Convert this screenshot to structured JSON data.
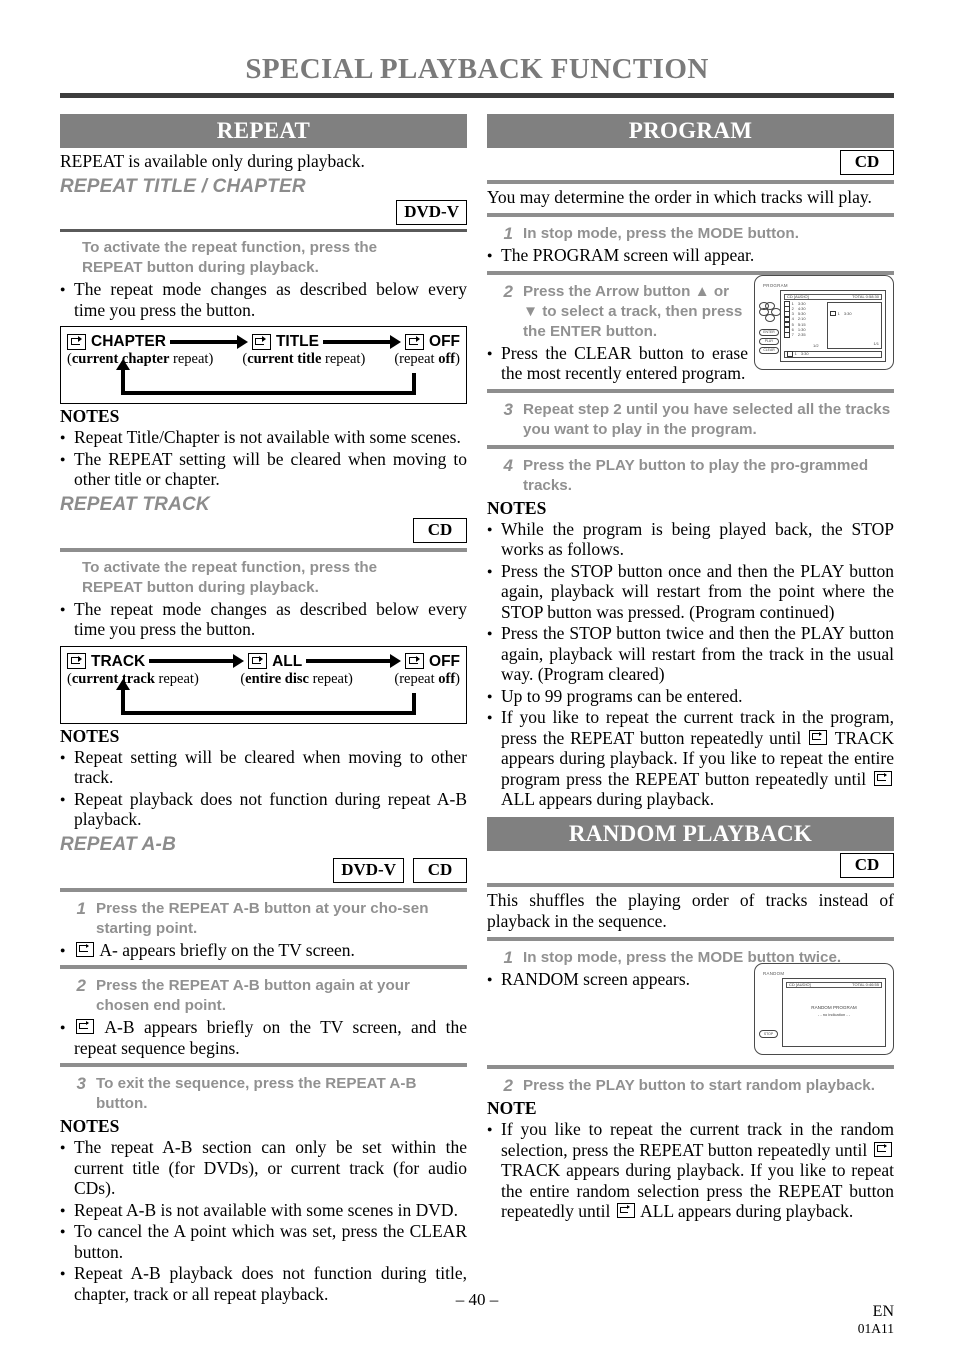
{
  "page_title": "SPECIAL PLAYBACK FUNCTION",
  "left": {
    "repeat": {
      "bar": "REPEAT",
      "intro": "REPEAT is available only during playback.",
      "title_chapter": {
        "subhead": "REPEAT TITLE / CHAPTER",
        "badges": [
          "DVD-V"
        ],
        "instruction_line1": "To activate the repeat function, press the",
        "instruction_line2": "REPEAT button during playback.",
        "bullet": "The repeat mode changes as described below every time you press the button.",
        "cycle": {
          "items": [
            {
              "label": "CHAPTER",
              "sub_bold": "current chapter",
              "sub_rest": " repeat"
            },
            {
              "label": "TITLE",
              "sub_bold": "current title",
              "sub_rest": " repeat"
            },
            {
              "label": "OFF",
              "sub_pre": "repeat ",
              "sub_bold": "off"
            }
          ]
        },
        "notes_heading": "NOTES",
        "notes": [
          "Repeat Title/Chapter is not available with some scenes.",
          "The REPEAT setting will be cleared when moving to other title or chapter."
        ]
      },
      "track": {
        "subhead": "REPEAT TRACK",
        "badges": [
          "CD"
        ],
        "instruction_line1": "To activate the repeat function, press the",
        "instruction_line2": "REPEAT button during playback.",
        "bullet": "The repeat mode changes as described below every time you press the button.",
        "cycle": {
          "items": [
            {
              "label": "TRACK",
              "sub_bold": "current track",
              "sub_rest": " repeat"
            },
            {
              "label": "ALL",
              "sub_bold": "entire disc",
              "sub_rest": " repeat"
            },
            {
              "label": "OFF",
              "sub_pre": "repeat ",
              "sub_bold": "off"
            }
          ]
        },
        "notes_heading": "NOTES",
        "notes": [
          "Repeat setting will be cleared when moving to other track.",
          "Repeat playback does not function during repeat A-B playback."
        ]
      },
      "ab": {
        "subhead": "REPEAT A-B",
        "badges": [
          "DVD-V",
          "CD"
        ],
        "steps": [
          {
            "num": "1",
            "text": "Press the REPEAT A-B button at your cho-sen starting point."
          },
          {
            "num": "2",
            "text": "Press the REPEAT A-B button again at your chosen end point."
          },
          {
            "num": "3",
            "text": "To exit the sequence, press the REPEAT A-B button."
          }
        ],
        "bullet1_pre": "",
        "bullet1_post": "A- appears briefly on the TV screen.",
        "bullet2_post": "A-B appears briefly on the TV screen, and the repeat sequence begins.",
        "notes_heading": "NOTES",
        "notes": [
          "The repeat A-B section can only be set within the current title (for DVDs), or current track (for audio CDs).",
          "Repeat A-B is not available with some scenes in DVD.",
          "To cancel the A point which was set, press the CLEAR button.",
          "Repeat A-B playback does not function during title, chapter, track or all repeat playback."
        ]
      }
    }
  },
  "right": {
    "program": {
      "bar": "PROGRAM",
      "badges": [
        "CD"
      ],
      "intro": "You may determine the order in which tracks will play.",
      "steps": [
        {
          "num": "1",
          "text": "In stop mode, press the MODE button."
        },
        {
          "num": "2",
          "text": "Press the Arrow button ▲ or ▼ to select a track, then press the ENTER button."
        },
        {
          "num": "3",
          "text": "Repeat step 2 until you have selected all the tracks you want to play in the program."
        },
        {
          "num": "4",
          "text": "Press the PLAY button to play the pro-grammed tracks."
        }
      ],
      "bullet_step1": "The PROGRAM screen will appear.",
      "bullet_step2": "Press the CLEAR button to erase the most recently entered program.",
      "screen": {
        "title": "PROGRAM",
        "disc": "CD [AUDIO]",
        "total": "TOTAL 0:58:30",
        "tracks": [
          {
            "no": "1",
            "time": "3:30"
          },
          {
            "no": "2",
            "time": "4:30"
          },
          {
            "no": "3",
            "time": "5:30"
          },
          {
            "no": "4",
            "time": "2:10"
          },
          {
            "no": "5",
            "time": "5:15"
          },
          {
            "no": "6",
            "time": "1:30"
          },
          {
            "no": "7",
            "time": "2:35"
          }
        ],
        "page_left": "1/2",
        "page_right": "1/1",
        "program_entry": {
          "no": "1",
          "time": "3:30"
        },
        "bottom_entry": {
          "no": "1",
          "time": "3:30"
        },
        "remote_buttons": [
          "ENTER",
          "PLAY",
          "CLEAR"
        ]
      },
      "notes_heading": "NOTES",
      "notes": [
        "While the program is being played back, the STOP works as follows.",
        "Press the STOP button once and then the PLAY button again, playback will restart from the point where the STOP button was pressed. (Program continued)",
        "Press the STOP button twice and then the PLAY button again, playback will restart from the track in the usual way. (Program cleared)",
        "Up to 99 programs can be entered."
      ],
      "note_repeat_part1": "If you like to repeat the current track in the program, press the REPEAT button repeatedly until",
      "note_repeat_part2": "TRACK appears during playback. If you like to repeat the entire program press the REPEAT button repeatedly until",
      "note_repeat_part3": "ALL appears during playback."
    },
    "random": {
      "bar": "RANDOM PLAYBACK",
      "badges": [
        "CD"
      ],
      "intro": "This shuffles the playing order of tracks instead of playback in the sequence.",
      "steps": [
        {
          "num": "1",
          "text": "In stop mode, press the MODE button twice."
        },
        {
          "num": "2",
          "text": "Press the PLAY button to start random playback."
        }
      ],
      "bullet_step1": "RANDOM screen appears.",
      "screen": {
        "title": "RANDOM",
        "disc": "CD [AUDIO]",
        "total": "TOTAL 0:46:55",
        "center_line1": "RANDOM PROGRAM",
        "center_line2": "- - no indication - -",
        "stop_button": "STOP"
      },
      "note_heading": "NOTE",
      "note_part1": "If you like to repeat the current track in the random selection, press the REPEAT button repeatedly until",
      "note_part2": "TRACK appears during playback. If you like to repeat the entire random selection press the REPEAT button repeatedly until",
      "note_part3": "ALL appears during playback."
    }
  },
  "footer": {
    "page_number": "– 40 –",
    "lang": "EN",
    "code": "01A11"
  }
}
